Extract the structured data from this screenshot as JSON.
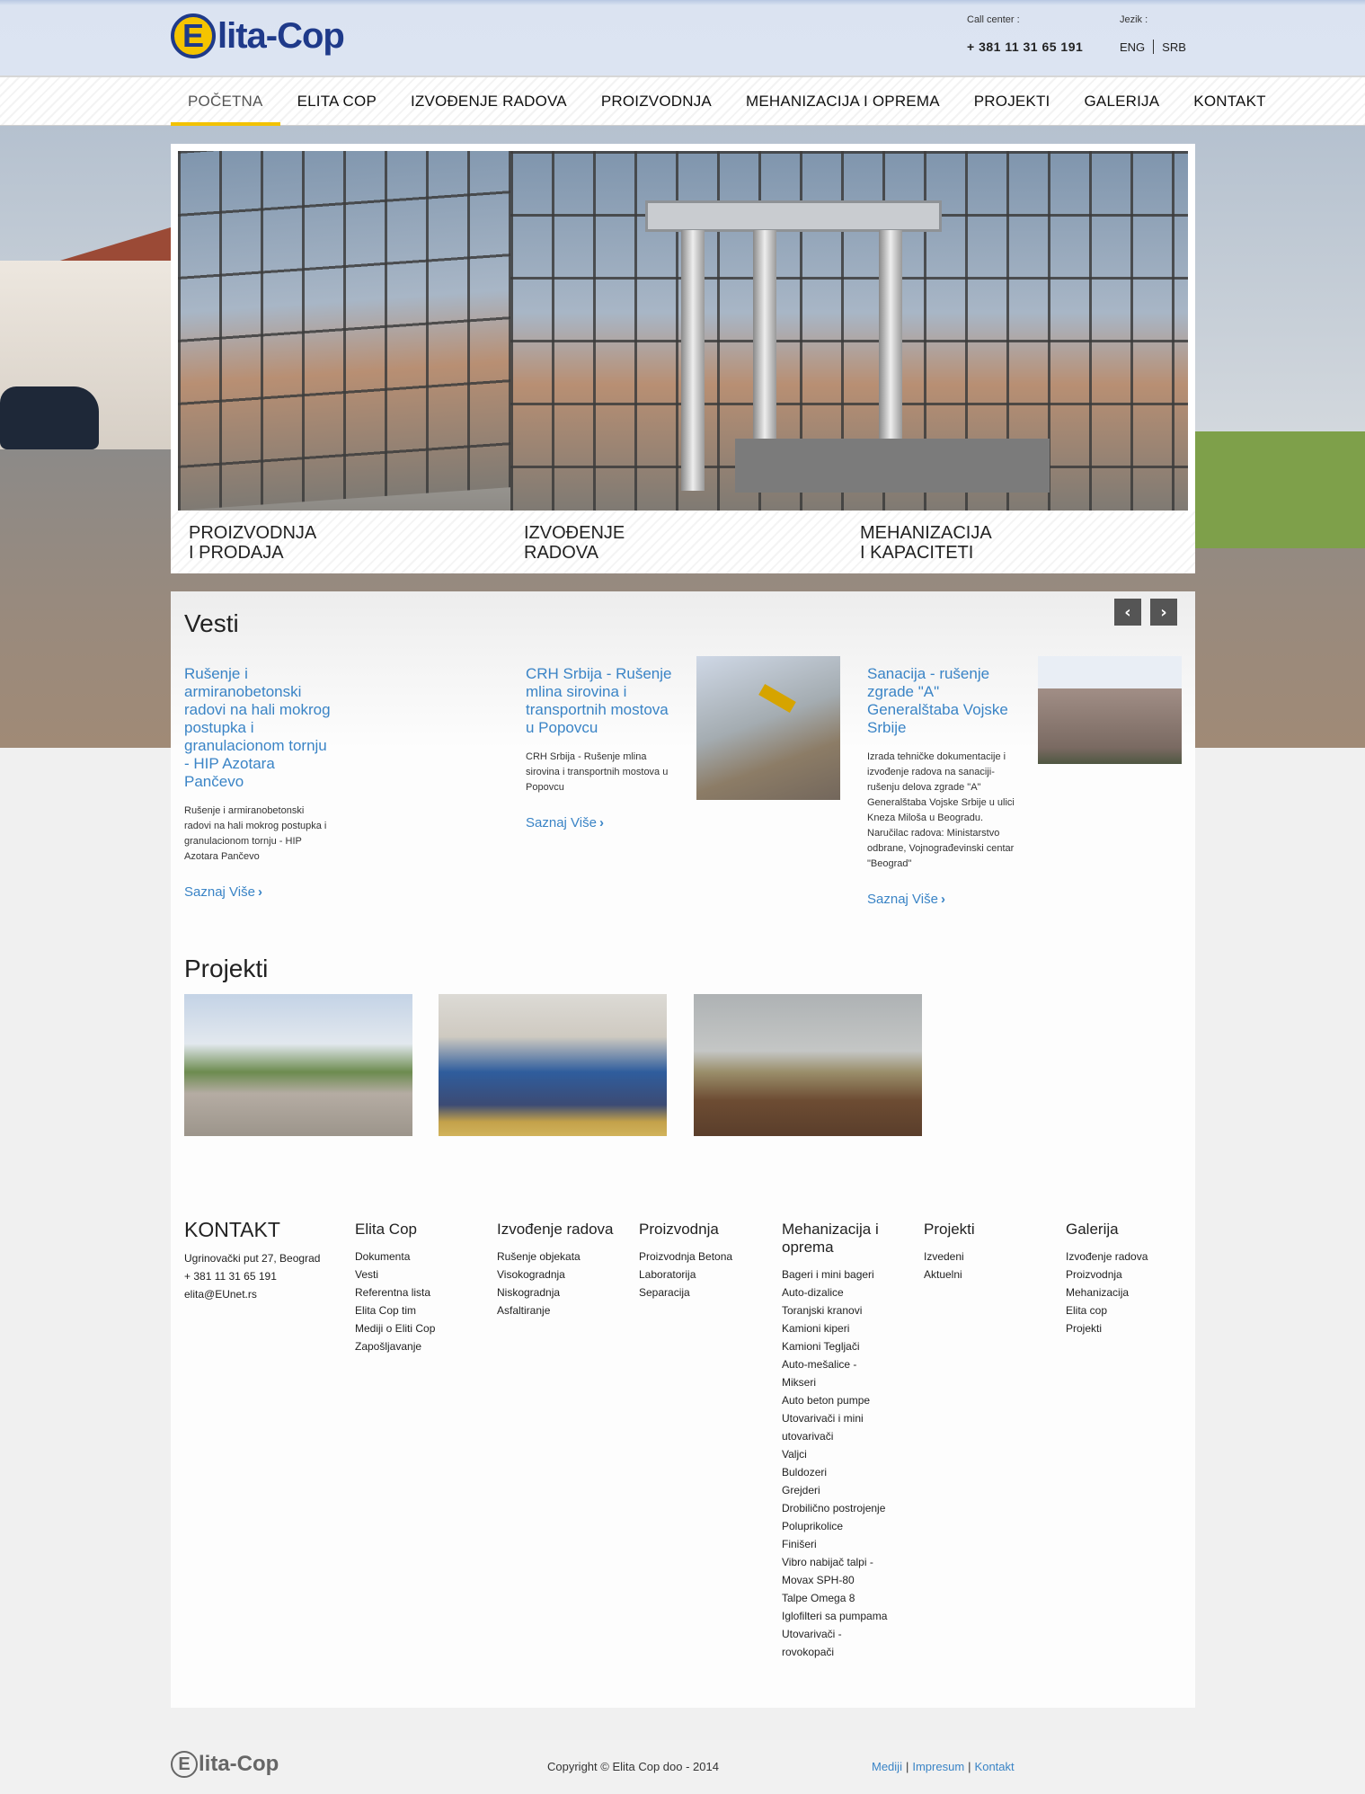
{
  "header": {
    "logo_text": "Elita-Cop",
    "call_label": "Call center :",
    "phone": "+ 381 11 31 65 191",
    "lang_label": "Jezik :",
    "langs": [
      "ENG",
      "SRB"
    ]
  },
  "nav": {
    "items": [
      "POČETNA",
      "ELITA COP",
      "IZVOĐENJE RADOVA",
      "PROIZVODNJA",
      "MEHANIZACIJA I OPREMA",
      "PROJEKTI",
      "GALERIJA",
      "KONTAKT"
    ],
    "active": "POČETNA",
    "accent": "#f2c200"
  },
  "slider": {
    "captions": [
      "PROIZVODNJA\nI PRODAJA",
      "IZVOĐENJE\nRADOVA",
      "MEHANIZACIJA\nI KAPACITETI"
    ]
  },
  "news": {
    "heading": "Vesti",
    "prev_icon": "chevron-left-icon",
    "next_icon": "chevron-right-icon",
    "more_label": "Saznaj Više",
    "items": [
      {
        "title": "Rušenje i armiranobetonski radovi na hali mokrog postupka i granulacionom tornju - HIP Azotara Pančevo",
        "text": "Rušenje i armiranobetonski radovi na hali mokrog postupka i granulacionom tornju - HIP Azotara Pančevo"
      },
      {
        "title": "CRH Srbija - Rušenje mlina sirovina i transportnih mostova u Popovcu",
        "text": "CRH Srbija - Rušenje mlina sirovina i transportnih mostova u Popovcu"
      },
      {
        "title": "Sanacija - rušenje zgrade \"A\" Generalštaba Vojske Srbije",
        "text": "Izrada tehničke dokumentacije i izvođenje radova na sanaciji-rušenju delova zgrade \"A\" Generalštaba Vojske Srbije u ulici Kneza Miloša u Beogradu. Naručilac radova: Ministarstvo odbrane, Vojnograđevinski centar \"Beograd\""
      }
    ],
    "link_color": "#3a84c6"
  },
  "projects": {
    "heading": "Projekti"
  },
  "footer": {
    "contact": {
      "heading": "KONTAKT",
      "lines": [
        "Ugrinovački put 27, Beograd",
        "+ 381 11 31 65 191",
        "elita@EUnet.rs"
      ]
    },
    "columns": [
      {
        "heading": "Elita Cop",
        "items": [
          "Dokumenta",
          "Vesti",
          "Referentna lista",
          "Elita Cop tim",
          "Mediji o Eliti Cop",
          "Zapošljavanje"
        ]
      },
      {
        "heading": "Izvođenje radova",
        "items": [
          "Rušenje objekata",
          "Visokogradnja",
          "Niskogradnja",
          "Asfaltiranje"
        ]
      },
      {
        "heading": "Proizvodnja",
        "items": [
          "Proizvodnja Betona",
          "Laboratorija",
          "Separacija"
        ]
      },
      {
        "heading": "Mehanizacija i oprema",
        "items": [
          "Bageri i mini bageri",
          "Auto-dizalice",
          "Toranjski kranovi",
          "Kamioni kiperi",
          "Kamioni Tegljači",
          "Auto-mešalice - Mikseri",
          "Auto beton pumpe",
          "Utovarivači i mini utovarivači",
          "Valjci",
          "Buldozeri",
          "Grejderi",
          "Drobilično postrojenje",
          "Poluprikolice",
          "Finišeri",
          "Vibro nabijač talpi - Movax SPH-80",
          "Talpe Omega 8",
          "Iglofilteri sa pumpama",
          "Utovarivači - rovokopači"
        ]
      },
      {
        "heading": "Projekti",
        "items": [
          "Izvedeni",
          "Aktuelni"
        ]
      },
      {
        "heading": "Galerija",
        "items": [
          "Izvođenje radova",
          "Proizvodnja",
          "Mehanizacija",
          "Elita cop",
          "Projekti"
        ]
      }
    ]
  },
  "bottom": {
    "logo_text": "Elita-Cop",
    "copyright": "Copyright © Elita Cop doo - 2014",
    "links": [
      "Mediji",
      "Impresum",
      "Kontakt"
    ]
  }
}
